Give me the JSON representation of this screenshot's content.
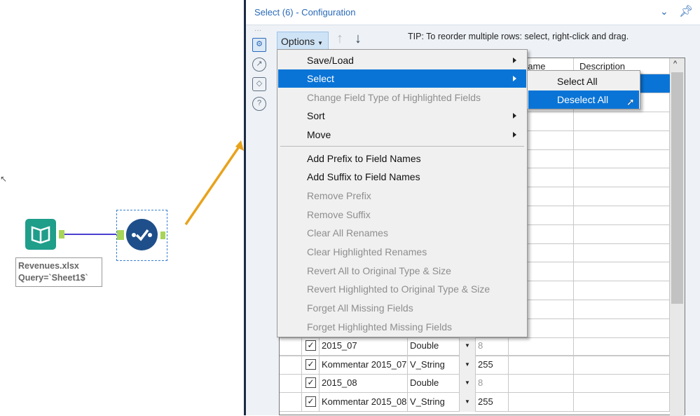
{
  "canvas": {
    "input_tool_label_line1": "Revenues.xlsx",
    "input_tool_label_line2": "Query=`Sheet1$`"
  },
  "panel": {
    "title": "Select (6) - Configuration",
    "tip": "TIP: To reorder multiple rows: select, right-click and drag.",
    "options_label": "Options"
  },
  "grid": {
    "headers": {
      "rename": "name",
      "description": "Description"
    },
    "rows": [
      {
        "field": "2015_07",
        "type": "Double",
        "size": "8",
        "size_dim": true
      },
      {
        "field": "Kommentar 2015_07",
        "type": "V_String",
        "size": "255",
        "size_dim": false
      },
      {
        "field": "2015_08",
        "type": "Double",
        "size": "8",
        "size_dim": true
      },
      {
        "field": "Kommentar 2015_08",
        "type": "V_String",
        "size": "255",
        "size_dim": false
      }
    ]
  },
  "menu": {
    "items": [
      {
        "label": "Save/Load"
      },
      {
        "label": "Select"
      },
      {
        "label": "Change Field Type of Highlighted Fields"
      },
      {
        "label": "Sort"
      },
      {
        "label": "Move"
      },
      {
        "label": "Add Prefix to Field Names"
      },
      {
        "label": "Add Suffix to Field Names"
      },
      {
        "label": "Remove Prefix"
      },
      {
        "label": "Remove Suffix"
      },
      {
        "label": "Clear All Renames"
      },
      {
        "label": "Clear Highlighted Renames"
      },
      {
        "label": "Revert All to Original Type & Size"
      },
      {
        "label": "Revert Highlighted to Original Type & Size"
      },
      {
        "label": "Forget All Missing Fields"
      },
      {
        "label": "Forget Highlighted Missing Fields"
      }
    ]
  },
  "submenu": {
    "items": [
      {
        "label": "Select All"
      },
      {
        "label": "Deselect All"
      }
    ]
  },
  "colors": {
    "accent": "#0a74d6",
    "connector": "#4b3fd0",
    "arrow": "#e8a21c",
    "input_tool": "#1f9e8a",
    "select_tool": "#1f4f8a"
  }
}
